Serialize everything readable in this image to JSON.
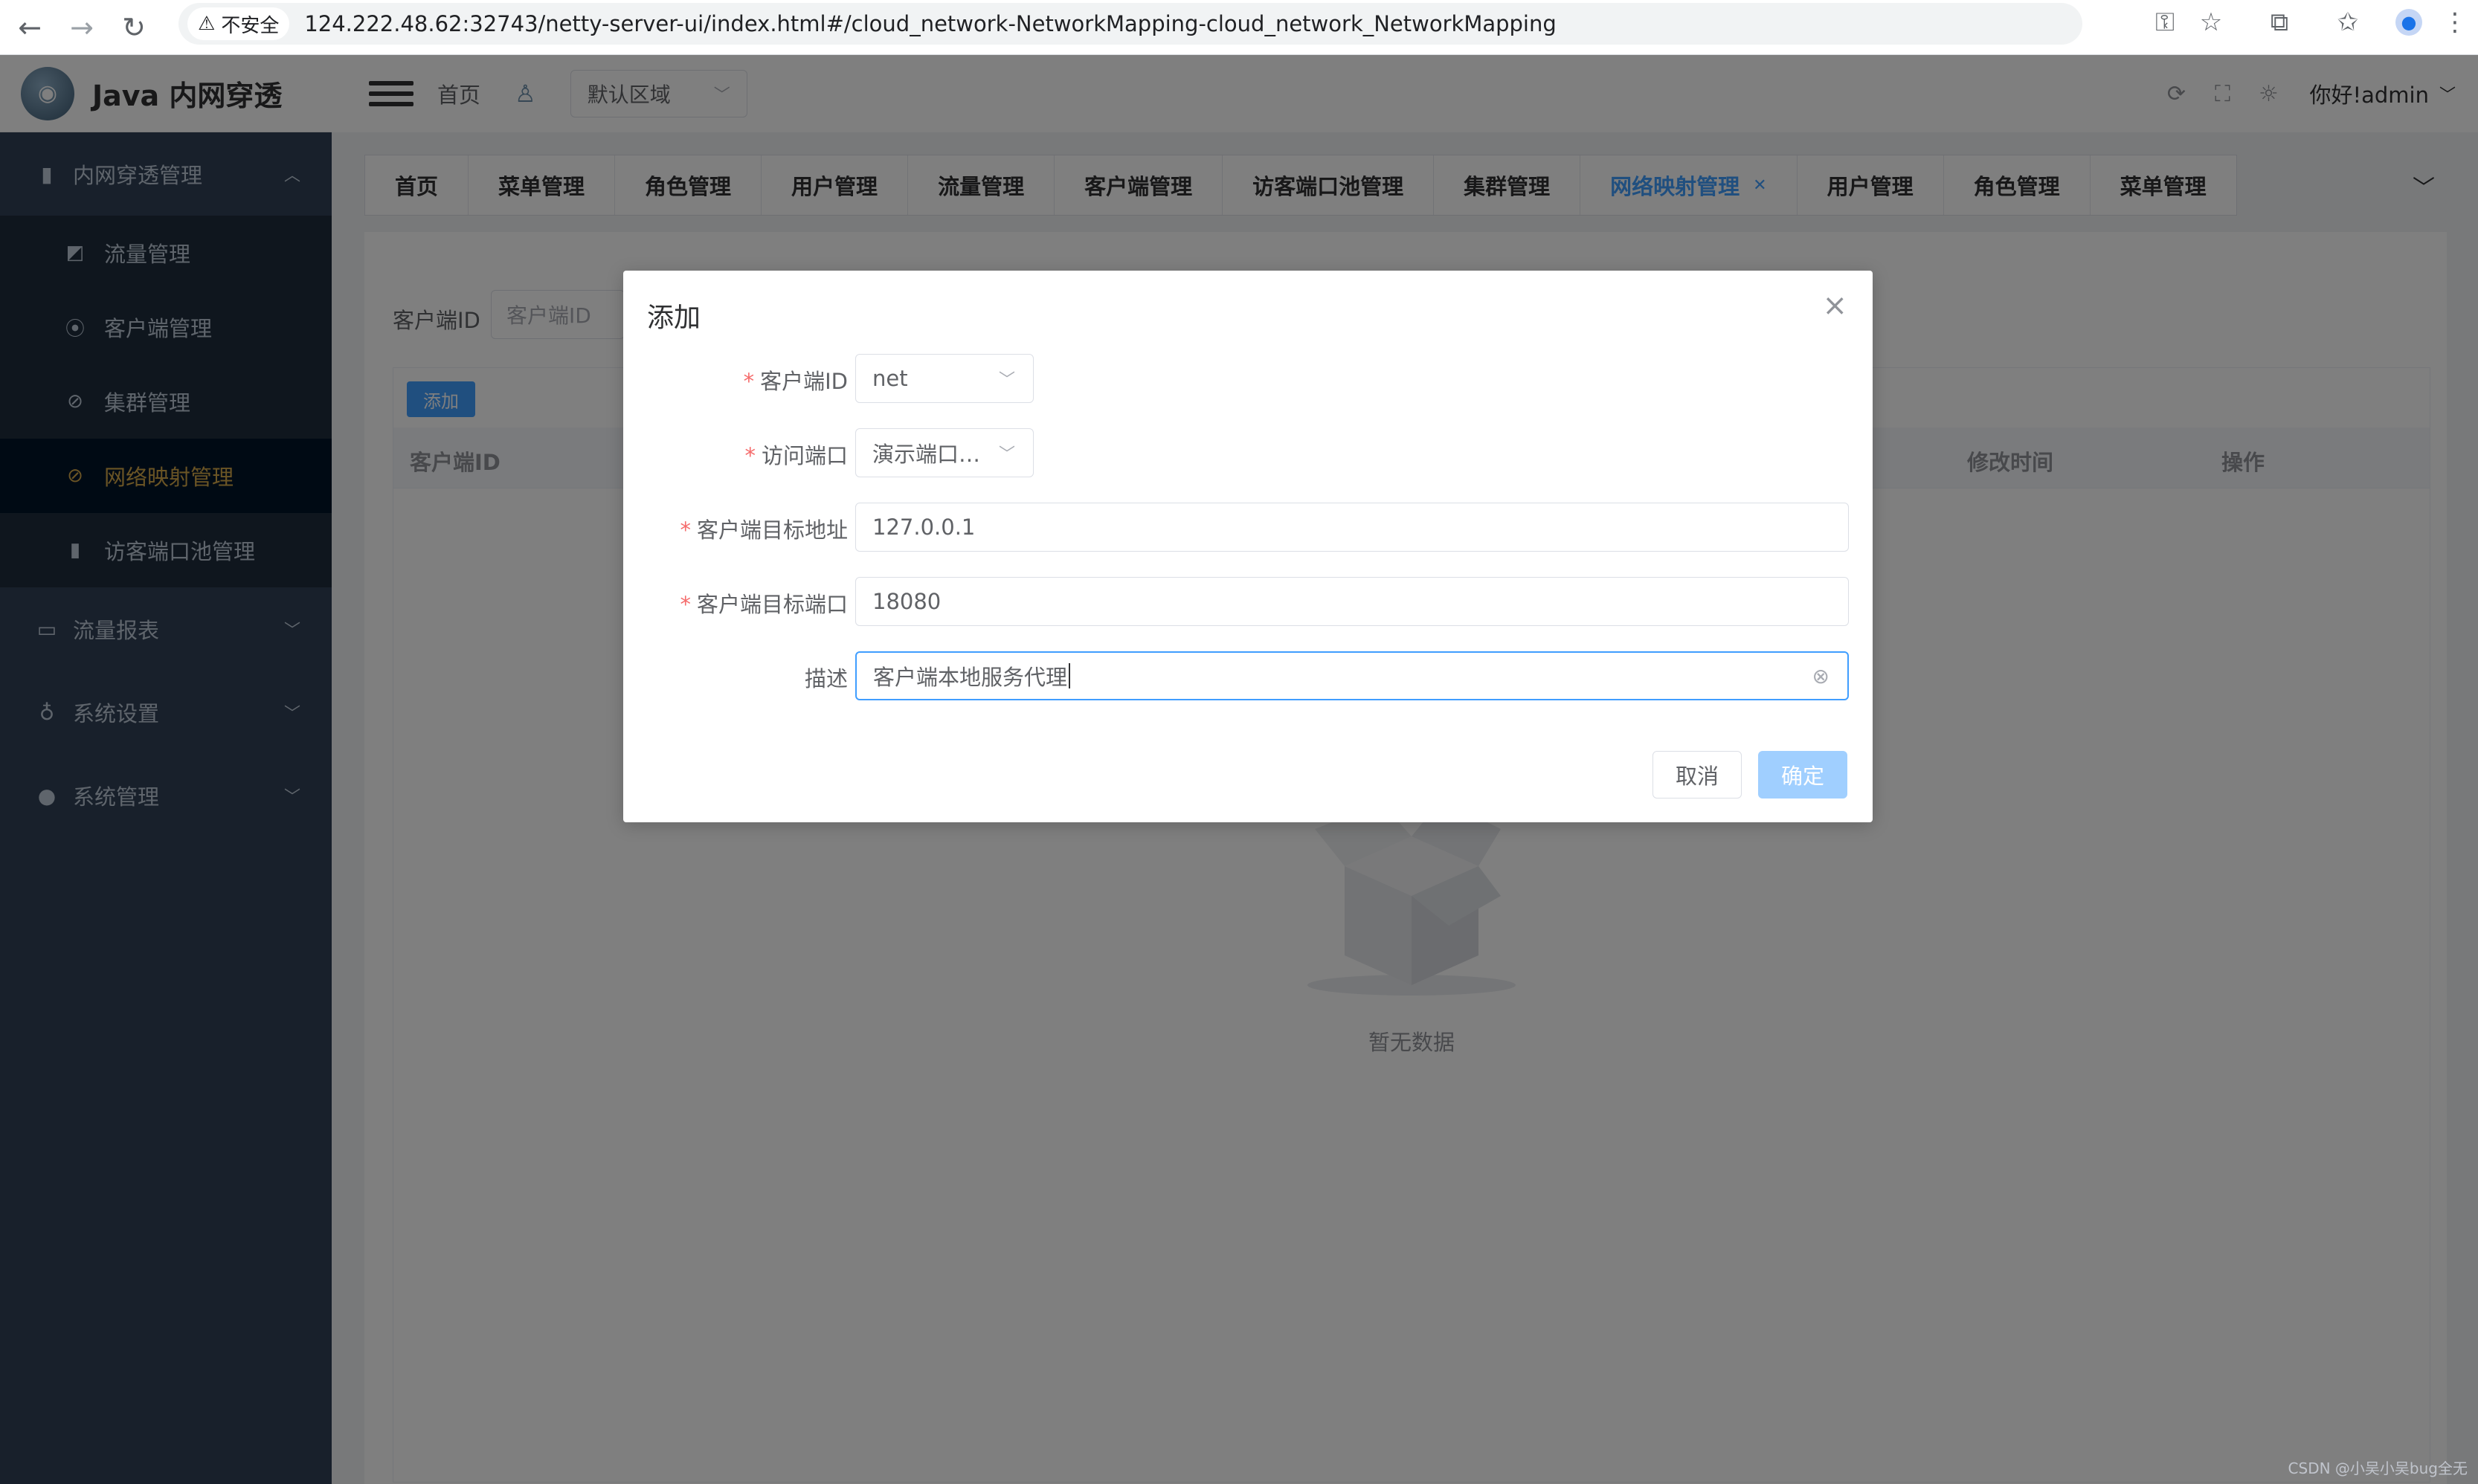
{
  "browser": {
    "insecure_label": "不安全",
    "url": "124.222.48.62:32743/netty-server-ui/index.html#/cloud_network-NetworkMapping-cloud_network_NetworkMapping"
  },
  "app": {
    "title": "Java 内网穿透"
  },
  "sidebar": {
    "groups": [
      {
        "label": "内网穿透管理"
      },
      {
        "label": "流量报表"
      },
      {
        "label": "系统设置"
      },
      {
        "label": "系统管理"
      }
    ],
    "sub_items": [
      {
        "label": "流量管理"
      },
      {
        "label": "客户端管理"
      },
      {
        "label": "集群管理"
      },
      {
        "label": "网络映射管理"
      },
      {
        "label": "访客端口池管理"
      }
    ]
  },
  "header": {
    "breadcrumb": "首页",
    "region": "默认区域",
    "greeting": "你好!admin"
  },
  "tabs": [
    {
      "label": "首页"
    },
    {
      "label": "菜单管理"
    },
    {
      "label": "角色管理"
    },
    {
      "label": "用户管理"
    },
    {
      "label": "流量管理"
    },
    {
      "label": "客户端管理"
    },
    {
      "label": "访客端口池管理"
    },
    {
      "label": "集群管理"
    },
    {
      "label": "网络映射管理"
    },
    {
      "label": "用户管理"
    },
    {
      "label": "角色管理"
    },
    {
      "label": "菜单管理"
    }
  ],
  "content": {
    "filter_label": "客户端ID",
    "filter_placeholder": "客户端ID",
    "add_button": "添加",
    "columns": {
      "client_id": "客户端ID",
      "modified_time": "修改时间",
      "actions": "操作"
    },
    "empty_text": "暂无数据"
  },
  "dialog": {
    "title": "添加",
    "fields": {
      "client_id": {
        "label": "客户端ID",
        "value": "net"
      },
      "visitor_port": {
        "label": "访问端口",
        "value": "演示端口…"
      },
      "target_address": {
        "label": "客户端目标地址",
        "value": "127.0.0.1"
      },
      "target_port": {
        "label": "客户端目标端口",
        "value": "18080"
      },
      "description": {
        "label": "描述",
        "value": "客户端本地服务代理"
      }
    },
    "cancel_label": "取消",
    "confirm_label": "确定"
  },
  "watermark": "CSDN @小吴小吴bug全无"
}
